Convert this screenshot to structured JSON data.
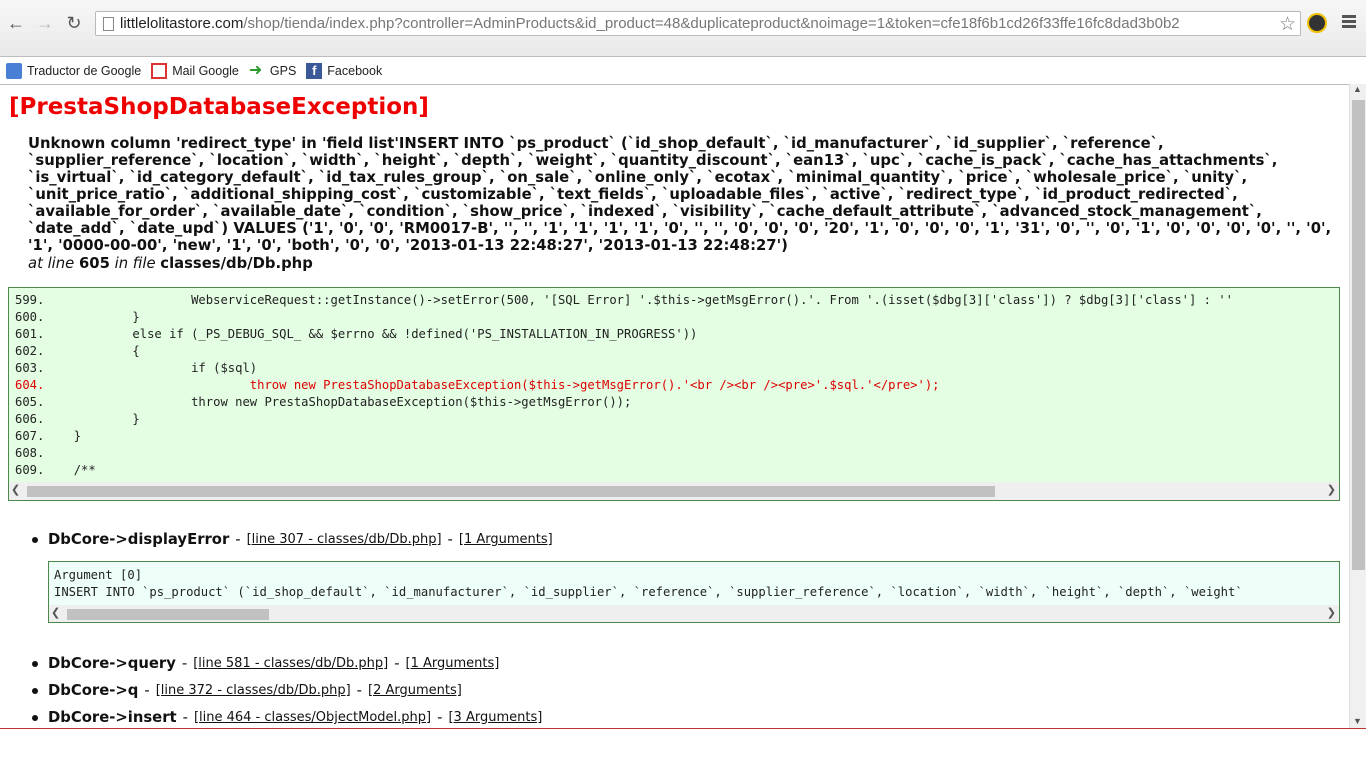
{
  "browser": {
    "url_host": "littlelolitastore.com",
    "url_path": "/shop/tienda/index.php?controller=AdminProducts&id_product=48&duplicateproduct&noimage=1&token=cfe18f6b1cd26f33ffe16fc8dad3b0b2",
    "nav_back": "←",
    "nav_forward": "→",
    "nav_reload": "↻",
    "star": "☆"
  },
  "bookmarks": [
    {
      "label": "Traductor de Google",
      "icon": "translate-icon"
    },
    {
      "label": "Mail Google",
      "icon": "gmail-icon"
    },
    {
      "label": "GPS",
      "icon": "arrow-icon"
    },
    {
      "label": "Facebook",
      "icon": "facebook-icon"
    }
  ],
  "exception": {
    "title": "[PrestaShopDatabaseException]",
    "message": "Unknown column 'redirect_type' in 'field list'INSERT INTO `ps_product` (`id_shop_default`, `id_manufacturer`, `id_supplier`, `reference`, `supplier_reference`, `location`, `width`, `height`, `depth`, `weight`, `quantity_discount`, `ean13`, `upc`, `cache_is_pack`, `cache_has_attachments`, `is_virtual`, `id_category_default`, `id_tax_rules_group`, `on_sale`, `online_only`, `ecotax`, `minimal_quantity`, `price`, `wholesale_price`, `unity`, `unit_price_ratio`, `additional_shipping_cost`, `customizable`, `text_fields`, `uploadable_files`, `active`, `redirect_type`, `id_product_redirected`, `available_for_order`, `available_date`, `condition`, `show_price`, `indexed`, `visibility`, `cache_default_attribute`, `advanced_stock_management`, `date_add`, `date_upd`) VALUES ('1', '0', '0', 'RM0017-B', '', '', '1', '1', '1', '1', '0', '', '', '0', '0', '0', '20', '1', '0', '0', '0', '1', '31', '0', '', '0', '1', '0', '0', '0', '0', '', '0', '1', '0000-00-00', 'new', '1', '0', 'both', '0', '0', '2013-01-13 22:48:27', '2013-01-13 22:48:27')",
    "at_line_label": "at line",
    "line": "605",
    "in_file_label": "in file",
    "file": "classes/db/Db.php"
  },
  "code": [
    {
      "num": "599.",
      "text": "                    WebserviceRequest::getInstance()->setError(500, '[SQL Error] '.$this->getMsgError().'. From '.(isset($dbg[3]['class']) ? $dbg[3]['class'] : ''",
      "hl": false
    },
    {
      "num": "600.",
      "text": "            }",
      "hl": false
    },
    {
      "num": "601.",
      "text": "            else if (_PS_DEBUG_SQL_ && $errno && !defined('PS_INSTALLATION_IN_PROGRESS'))",
      "hl": false
    },
    {
      "num": "602.",
      "text": "            {",
      "hl": false
    },
    {
      "num": "603.",
      "text": "                    if ($sql)",
      "hl": false
    },
    {
      "num": "604.",
      "text": "                            throw new PrestaShopDatabaseException($this->getMsgError().'<br /><br /><pre>'.$sql.'</pre>');",
      "hl": true
    },
    {
      "num": "605.",
      "text": "                    throw new PrestaShopDatabaseException($this->getMsgError());",
      "hl": false
    },
    {
      "num": "606.",
      "text": "            }",
      "hl": false
    },
    {
      "num": "607.",
      "text": "    }",
      "hl": false
    },
    {
      "num": "608.",
      "text": "",
      "hl": false
    },
    {
      "num": "609.",
      "text": "    /**",
      "hl": false
    }
  ],
  "trace": [
    {
      "fn": "DbCore->displayError",
      "line_link": "[line 307 - classes/db/Db.php]",
      "args_link": "[1 Arguments]"
    },
    {
      "fn": "DbCore->query",
      "line_link": "[line 581 - classes/db/Db.php]",
      "args_link": "[1 Arguments]"
    },
    {
      "fn": "DbCore->q",
      "line_link": "[line 372 - classes/db/Db.php]",
      "args_link": "[2 Arguments]"
    },
    {
      "fn": "DbCore->insert",
      "line_link": "[line 464 - classes/ObjectModel.php]",
      "args_link": "[3 Arguments]"
    }
  ],
  "argument": {
    "label": "Argument [0]",
    "value": "INSERT INTO `ps_product` (`id_shop_default`, `id_manufacturer`, `id_supplier`, `reference`, `supplier_reference`, `location`, `width`, `height`, `depth`, `weight`"
  },
  "separator": "-"
}
